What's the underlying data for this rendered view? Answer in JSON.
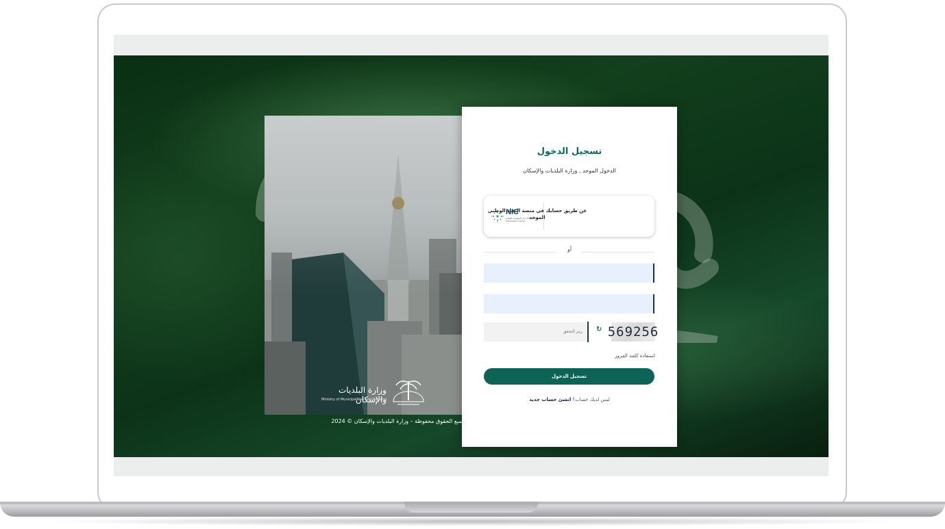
{
  "login": {
    "title": "تسجيل الدخول",
    "subtitle": "الدخول الموحد , وزارة البلديات والإسكان",
    "nafath_text": "عن طريق حسابك في منصة النفاذ الوطني الموحد",
    "nic_logo_text": "NIC",
    "nic_logo_subtext": "مركز المعلومات الوطني National Information Center",
    "or_label": "أو",
    "username_placeholder": "",
    "password_placeholder": "",
    "captcha_placeholder": "رمز التحقق",
    "captcha_code": "569256",
    "forgot_password": "استعادة كلمة المرور",
    "login_button": "تسجيل الدخول",
    "no_account": "ليس لديك حساب؟",
    "create_account": "انشئ حساب جديد"
  },
  "branding": {
    "ministry_name_ar": "وزارة البلديات والإسكان",
    "ministry_name_en": "Ministry of Municipalities and Housing",
    "copyright": "جميع الحقوق محفوظة – وزارة البلديات والإسكان © 2024"
  },
  "icons": {
    "refresh": "refresh-icon",
    "nic": "nic-logo-icon",
    "ministry": "ministry-palm-logo"
  },
  "colors": {
    "primary": "#0d6356",
    "title": "#0b6b5b",
    "link": "#23145c",
    "field_bg": "#e8f0fe"
  }
}
